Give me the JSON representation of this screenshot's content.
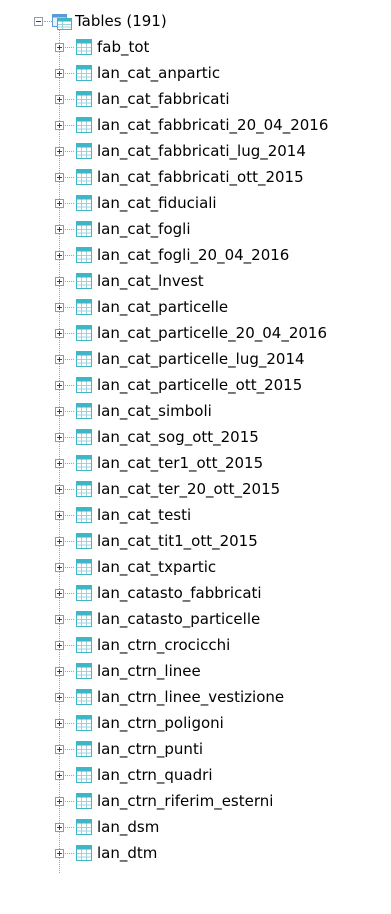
{
  "tree": {
    "root": {
      "label": "Tables (191)",
      "expanded": true,
      "icon": "tables-folder-icon"
    },
    "item_icon": "table-icon",
    "items": [
      "fab_tot",
      "lan_cat_anpartic",
      "lan_cat_fabbricati",
      "lan_cat_fabbricati_20_04_2016",
      "lan_cat_fabbricati_lug_2014",
      "lan_cat_fabbricati_ott_2015",
      "lan_cat_fiduciali",
      "lan_cat_fogli",
      "lan_cat_fogli_20_04_2016",
      "lan_cat_lnvest",
      "lan_cat_particelle",
      "lan_cat_particelle_20_04_2016",
      "lan_cat_particelle_lug_2014",
      "lan_cat_particelle_ott_2015",
      "lan_cat_simboli",
      "lan_cat_sog_ott_2015",
      "lan_cat_ter1_ott_2015",
      "lan_cat_ter_20_ott_2015",
      "lan_cat_testi",
      "lan_cat_tit1_ott_2015",
      "lan_cat_txpartic",
      "lan_catasto_fabbricati",
      "lan_catasto_particelle",
      "lan_ctrn_crocicchi",
      "lan_ctrn_linee",
      "lan_ctrn_linee_vestizione",
      "lan_ctrn_poligoni",
      "lan_ctrn_punti",
      "lan_ctrn_quadri",
      "lan_ctrn_riferim_esterni",
      "lan_dsm",
      "lan_dtm"
    ],
    "colors": {
      "text": "#000000",
      "tree_line": "#a0a0a0",
      "expander_border": "#8f9ba8",
      "icon_blue": "#5b9bd5",
      "icon_teal": "#3fb6c8"
    }
  }
}
